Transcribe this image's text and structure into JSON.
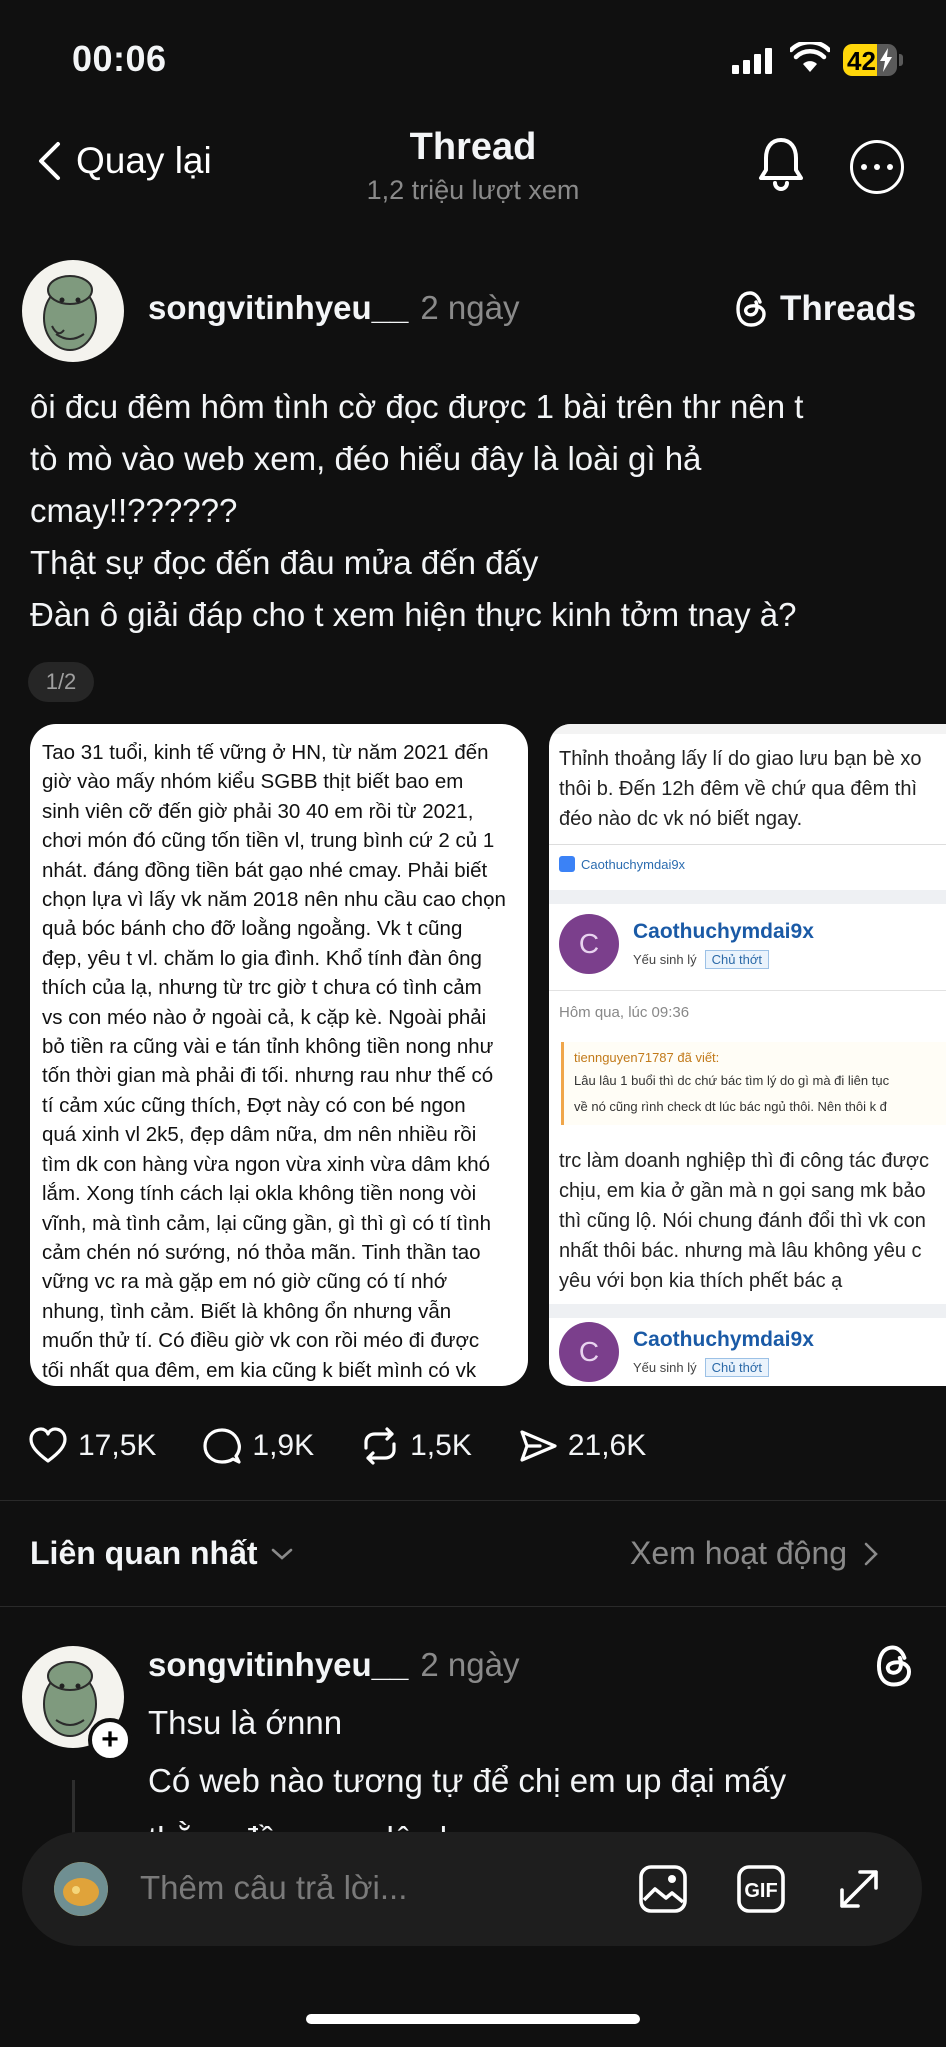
{
  "status_bar": {
    "time": "00:06",
    "battery": "42"
  },
  "header": {
    "back_label": "Quay lại",
    "title": "Thread",
    "subtitle": "1,2 triệu lượt xem"
  },
  "post": {
    "username": "songvitinhyeu__",
    "time_ago": "2 ngày",
    "app_label": "Threads",
    "text_lines": [
      "ôi đcu đêm hôm tình cờ đọc được 1 bài trên thr nên t",
      "tò mò vào web xem, đéo hiểu đây là loài gì hả",
      "cmay!!??????",
      "Thật sự đọc đến đâu mửa đến đấy",
      "Đàn ô giải đáp cho t xem hiện thực kinh tởm tnay à?"
    ],
    "pager": "1/2",
    "image1_lines": [
      "Tao 31 tuổi, kinh tế vững ở HN, từ năm 2021 đến",
      "giờ vào mấy nhóm kiểu SGBB thịt biết bao em",
      "sinh viên cỡ đến giờ phải 30 40 em rồi từ 2021,",
      "chơi món đó cũng tốn tiền vl, trung bình cứ 2 củ 1",
      "nhát. đáng đồng tiền bát gạo nhé cmay. Phải biết",
      "chọn lựa vì lấy vk năm 2018 nên nhu cầu cao chọn",
      "quả bóc bánh cho đỡ loằng ngoằng. Vk t cũng",
      "đẹp, yêu t vl. chăm lo gia đình. Khổ tính đàn ông",
      "thích của lạ, nhưng từ trc giờ t chưa có tình cảm",
      "vs con méo nào ở ngoài cả, k cặp kè. Ngoài phải",
      "bỏ tiền ra cũng vài e tán tỉnh không tiền nong như",
      "tốn thời gian mà phải đi tối. nhưng rau như thế có",
      "tí cảm xúc cũng thích, Đợt này có con bé ngon",
      "quá xinh vl 2k5, đẹp dâm nữa, dm nên nhiều rồi",
      "tìm dk con hàng vừa ngon vừa xinh vừa dâm khó",
      "lắm. Xong tính cách lại okla không tiền nong vòi",
      "vĩnh, mà tình cảm, lại cũng gần, gì thì gì có tí tình",
      "cảm chén nó sướng, nó thỏa mãn. Tinh thần tao",
      "vững vc ra mà gặp em nó giờ cũng có tí nhớ",
      "nhung, tình cảm. Biết là không ổn nhưng vẫn",
      "muốn thử tí. Có điều giờ vk con rồi méo đi được",
      "tối nhất qua đêm, em kia cũng k biết mình có vk"
    ],
    "image2": {
      "top_lines": [
        "Thỉnh thoảng lấy lí do giao lưu bạn bè xo",
        "thôi b. Đến 12h đêm về chứ qua đêm thì",
        "đéo nào dc vk nó biết ngay."
      ],
      "like_user": "Caothuchymdai9x",
      "poster_initial": "C",
      "poster_name": "Caothuchymdai9x",
      "poster_role": "Yếu sinh lý",
      "poster_tag": "Chủ thớt",
      "date": "Hôm qua, lúc 09:36",
      "quote_header": "tiennguyen71787 đã viết:",
      "quote_lines": [
        "Lâu lâu 1 buổi thì dc chứ bác tìm lý do gì mà đi liên tục",
        "về nó cũng rình check dt lúc bác ngủ thôi. Nên thôi k đ"
      ],
      "body_lines": [
        "trc làm doanh nghiệp thì đi công tác được",
        "chịu, em kia ở gần mà n gọi sang mk bảo",
        "thì cũng lộ. Nói chung đánh đổi thì vk con",
        "nhất thôi bác. nhưng mà lâu không yêu c",
        "yêu với bọn kia thích phết bác ạ"
      ],
      "poster2_initial": "C",
      "poster2_name": "Caothuchymdai9x",
      "poster2_role": "Yếu sinh lý",
      "poster2_tag": "Chủ thớt"
    },
    "likes": "17,5K",
    "comments": "1,9K",
    "reposts": "1,5K",
    "shares": "21,6K"
  },
  "replies_bar": {
    "sort_label": "Liên quan nhất",
    "activity_label": "Xem hoạt động"
  },
  "reply": {
    "username": "songvitinhyeu__",
    "time_ago": "2 ngày",
    "lines": [
      "Thsu là ớnnn",
      "Có web nào tương tự để chị em up đại mấy",
      "thằng đồng ang lên kooo"
    ]
  },
  "composer": {
    "placeholder": "Thêm câu trả lời..."
  },
  "icons": {
    "back": "chevron-left-icon",
    "bell": "bell-icon",
    "more": "more-icon",
    "threads": "threads-logo-icon",
    "like": "heart-icon",
    "comment": "comment-icon",
    "repost": "repost-icon",
    "share": "send-icon",
    "image": "image-icon",
    "gif": "gif-icon",
    "expand": "expand-icon"
  }
}
